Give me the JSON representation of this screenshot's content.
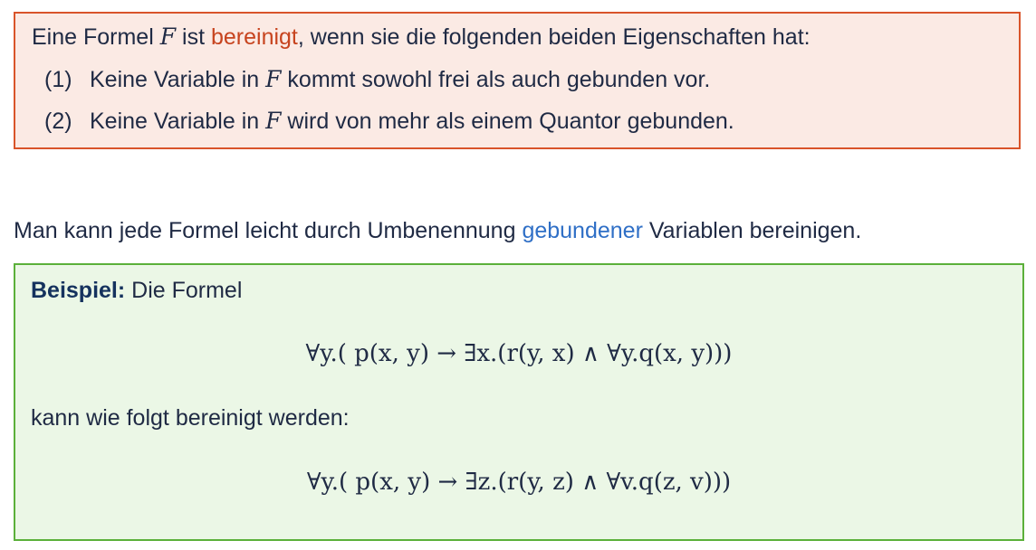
{
  "definition": {
    "intro_prefix": "Eine Formel ",
    "intro_var": "F",
    "intro_mid": " ist ",
    "intro_term": "bereinigt",
    "intro_suffix": ", wenn sie die folgenden beiden Eigenschaften hat:",
    "items": [
      {
        "number": "(1)",
        "prefix": "Keine Variable in ",
        "var": "F",
        "suffix": " kommt sowohl frei als auch gebunden vor."
      },
      {
        "number": "(2)",
        "prefix": "Keine Variable in ",
        "var": "F",
        "suffix": " wird von mehr als einem Quantor gebunden."
      }
    ]
  },
  "middle": {
    "prefix": "Man kann jede Formel leicht durch Umbenennung ",
    "term": "gebundener",
    "suffix": " Variablen bereinigen."
  },
  "example": {
    "label": "Beispiel:",
    "intro": " Die Formel",
    "formula_original": "∀y.( p(x, y) → ∃x.(r(y, x) ∧ ∀y.q(x, y)))",
    "middle": "kann wie folgt bereinigt werden:",
    "formula_cleaned": "∀y.( p(x, y) → ∃z.(r(y, z) ∧ ∀v.q(z, v)))"
  },
  "colors": {
    "definition_border": "#d9542a",
    "definition_background": "#fbeae4",
    "definition_term": "#c7441f",
    "middle_term": "#2f6fc6",
    "example_border": "#5bb03a",
    "example_background": "#ebf7e6",
    "text": "#1f2a44"
  }
}
